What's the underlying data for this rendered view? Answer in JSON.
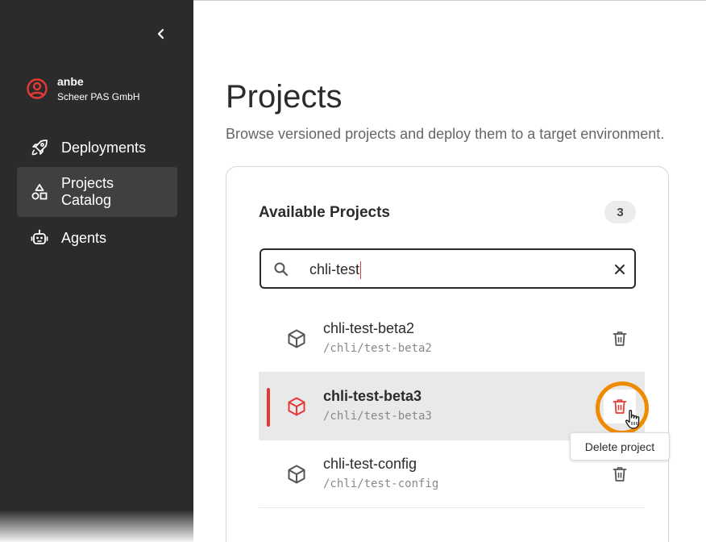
{
  "user": {
    "name": "anbe",
    "organization": "Scheer PAS GmbH"
  },
  "nav": {
    "deployments": "Deployments",
    "projects_catalog": "Projects Catalog",
    "agents": "Agents"
  },
  "page": {
    "title": "Projects",
    "subtitle": "Browse versioned projects and deploy them to a target environment."
  },
  "card": {
    "title": "Available Projects",
    "count": "3"
  },
  "search": {
    "value": "chli-test"
  },
  "projects": [
    {
      "name": "chli-test-beta2",
      "path": "/chli/test-beta2",
      "selected": false
    },
    {
      "name": "chli-test-beta3",
      "path": "/chli/test-beta3",
      "selected": true
    },
    {
      "name": "chli-test-config",
      "path": "/chli/test-config",
      "selected": false
    }
  ],
  "tooltip": {
    "text": "Delete project"
  },
  "colors": {
    "sidebar_bg": "#2b2b2b",
    "accent_red": "#e53935",
    "highlight_orange": "#f08a00",
    "selected_row_bg": "#e9e9e9"
  },
  "icons": {
    "collapse": "chevron-left-icon",
    "user": "user-circle-icon",
    "deployments": "rocket-icon",
    "projects_catalog": "shapes-icon",
    "agents": "robot-icon",
    "search": "search-icon",
    "clear": "close-icon",
    "project": "cube-icon",
    "delete": "trash-icon"
  }
}
